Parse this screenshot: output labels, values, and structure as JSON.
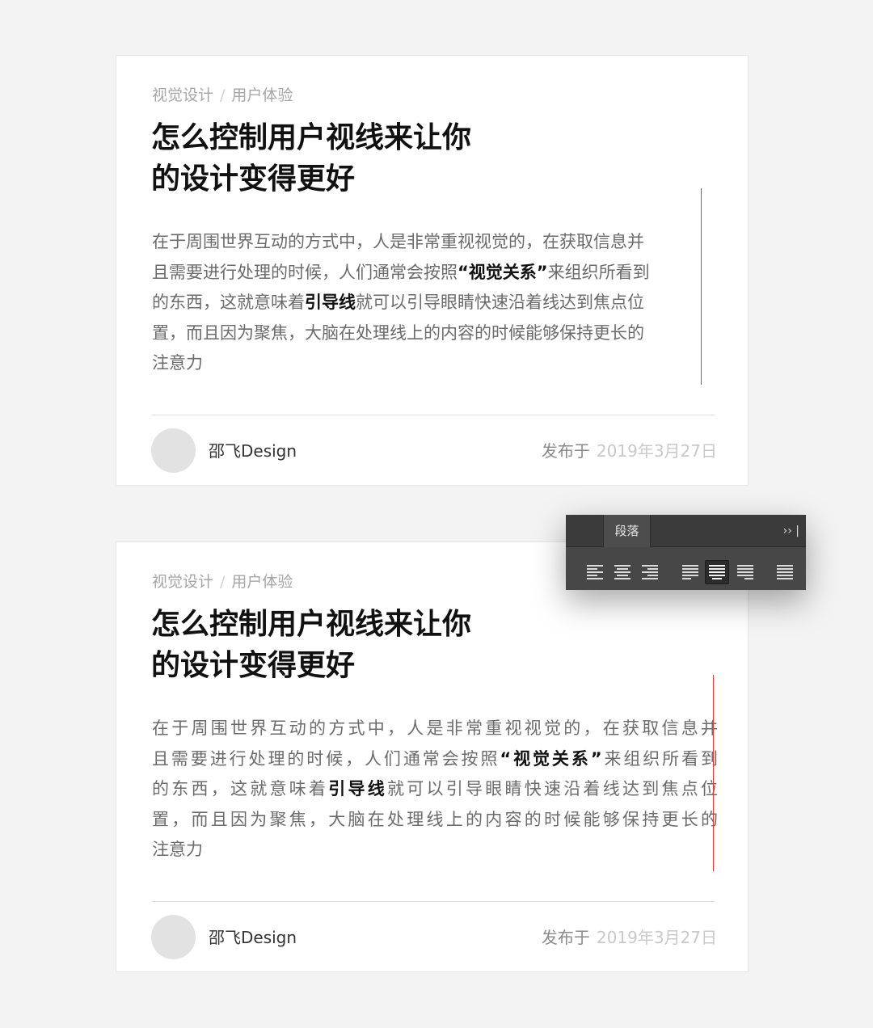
{
  "cards": [
    {
      "category": "视觉设计",
      "separator": "/",
      "subcategory": "用户体验",
      "title_lines": [
        "怎么控制用户视线来让你",
        "的设计变得更好"
      ],
      "body_lines": [
        {
          "pre": "在于周围世界互动的方式中，人是非常重视视觉的，在获取信息并",
          "bold": "",
          "post": ""
        },
        {
          "pre": "且需要进行处理的时候，人们通常会按照",
          "bold": "“视觉关系”",
          "post": "来组织所看到"
        },
        {
          "pre": "的东西，这就意味着",
          "bold": "引导线",
          "post": "就可以引导眼睛快速沿着线达到焦点位"
        },
        {
          "pre": "置，而且因为聚焦，大脑在处理线上的内容的时候能够保持更长的",
          "bold": "",
          "post": ""
        },
        {
          "pre": "注意力",
          "bold": "",
          "post": ""
        }
      ],
      "author": "邵飞Design",
      "published_label": "发布于",
      "published_date": "2019年3月27日"
    },
    {
      "category": "视觉设计",
      "separator": "/",
      "subcategory": "用户体验",
      "title_lines": [
        "怎么控制用户视线来让你",
        "的设计变得更好"
      ],
      "body_lines": [
        {
          "pre": "在于周围世界互动的方式中，人是非常重视视觉的，在获取信息并",
          "bold": "",
          "post": ""
        },
        {
          "pre": "且需要进行处理的时候，人们通常会按照",
          "bold": "“视觉关系”",
          "post": "来组织所看到"
        },
        {
          "pre": "的东西，这就意味着",
          "bold": "引导线",
          "post": "就可以引导眼睛快速沿着线达到焦点位"
        },
        {
          "pre": "置，而且因为聚焦，大脑在处理线上的内容的时候能够保持更长的",
          "bold": "",
          "post": ""
        },
        {
          "pre": "注意力",
          "bold": "",
          "post": ""
        }
      ],
      "author": "邵飞Design",
      "published_label": "发布于",
      "published_date": "2019年3月27日"
    }
  ],
  "panel": {
    "tab_label": "段落",
    "expand_label": "›› |",
    "active_button": "justify-last-centered",
    "buttons": [
      {
        "name": "align-left",
        "icon": "align-left-icon"
      },
      {
        "name": "align-center",
        "icon": "align-center-icon"
      },
      {
        "name": "align-right",
        "icon": "align-right-icon"
      },
      {
        "name": "justify-last-left",
        "icon": "justify-last-left-icon"
      },
      {
        "name": "justify-last-centered",
        "icon": "justify-last-centered-icon"
      },
      {
        "name": "justify-last-right",
        "icon": "justify-last-right-icon"
      },
      {
        "name": "justify-all",
        "icon": "justify-all-icon"
      }
    ]
  },
  "colors": {
    "page_background": "#f3f3f3",
    "card_background": "#ffffff",
    "guide_line": "#e23b3b",
    "panel_background": "#474747",
    "panel_header": "#3b3b3b"
  }
}
